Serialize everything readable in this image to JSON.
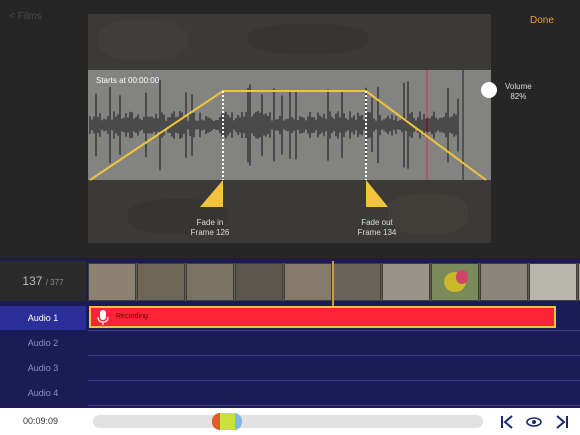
{
  "nav": {
    "back_label": "< Films",
    "done_label": "Done"
  },
  "audio_editor": {
    "starts_at": "Starts at 00:00:00",
    "volume_title": "Volume",
    "volume_value": "82%",
    "fade_in_title": "Fade in",
    "fade_in_frame": "Frame 126",
    "fade_out_title": "Fade out",
    "fade_out_frame": "Frame 134"
  },
  "timeline": {
    "frame_current": "137",
    "frame_total": "/ 377",
    "tracks": [
      {
        "label": "Audio 1"
      },
      {
        "label": "Audio 2"
      },
      {
        "label": "Audio 3"
      },
      {
        "label": "Audio 4"
      }
    ],
    "clip_label": "Recording"
  },
  "playback": {
    "time": "00:09:09"
  },
  "colors": {
    "accent": "#e8a32b",
    "track_bg": "#1b1c57",
    "clip_fill": "#ff2435",
    "clip_border": "#f3c33a"
  }
}
